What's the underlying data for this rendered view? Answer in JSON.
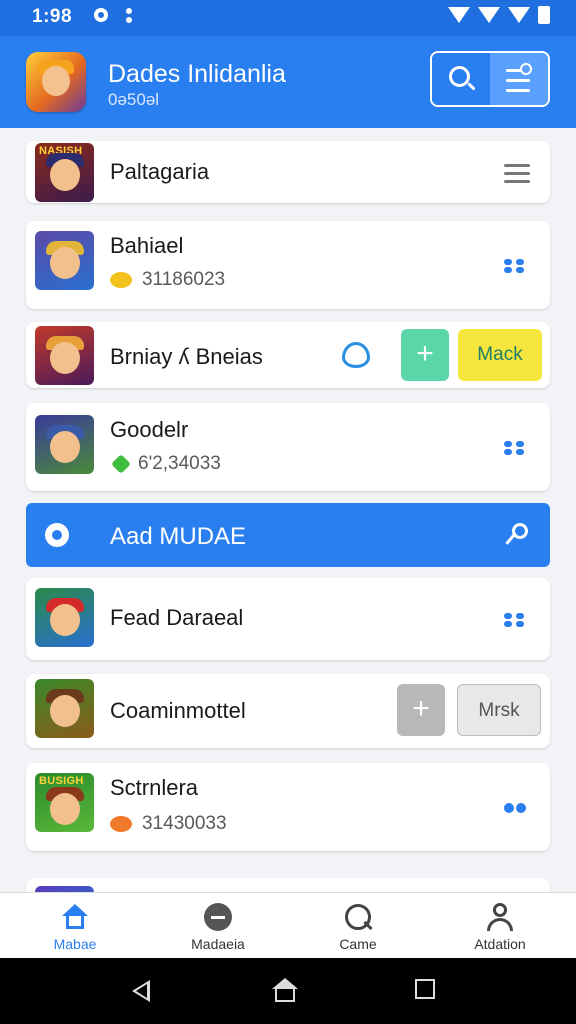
{
  "status_bar": {
    "time": "1:98"
  },
  "header": {
    "title": "Dades Inlidanlia",
    "subtitle": "0ǝ50ǝl"
  },
  "items": [
    {
      "name": "Paltagaria",
      "thumb_tag": "NASISH"
    },
    {
      "name": "Bahiael",
      "value": "31186023"
    },
    {
      "name": "Brniay ʎ Bneias",
      "add": "+",
      "action": "Mack"
    },
    {
      "name": "Goodelr",
      "value": "6'2,34033"
    },
    {
      "name": "Fead Daraeal"
    },
    {
      "name": "Coaminmottel",
      "add": "+",
      "action": "Mrsk"
    },
    {
      "name": "Sctrnlera",
      "thumb_tag": "BUSIGH",
      "value": "31430033"
    }
  ],
  "highlight": {
    "label": "Aad MUDAE"
  },
  "bottom_nav": [
    {
      "label": "Mabae",
      "icon": "home-icon",
      "active": true
    },
    {
      "label": "Madaeia",
      "icon": "media-icon",
      "active": false
    },
    {
      "label": "Came",
      "icon": "search-icon",
      "active": false
    },
    {
      "label": "Atdation",
      "icon": "person-icon",
      "active": false
    }
  ],
  "colors": {
    "primary": "#2a7ff0",
    "green": "#5ad6a8",
    "yellow": "#f6e53c",
    "grey_btn": "#b8b8b8"
  }
}
